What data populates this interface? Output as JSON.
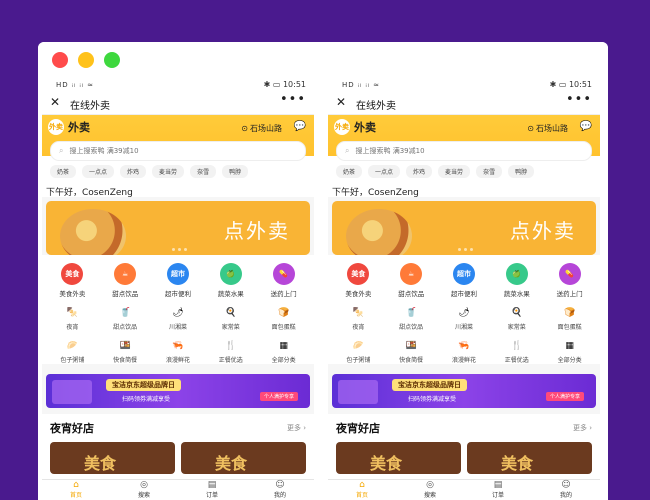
{
  "status": {
    "signal": "HD ᵢₗ ᵢₗ ≈",
    "time": "10:51",
    "battery": "✱ ▭"
  },
  "nav": {
    "title": "在线外卖"
  },
  "brand": {
    "logo_text": "外卖",
    "name": "外卖",
    "location": "石场山路"
  },
  "search": {
    "placeholder": "搜上搜索鸭 满39减10"
  },
  "tags": [
    "奶茶",
    "一点点",
    "炸鸡",
    "麦当劳",
    "奈雪",
    "鸭脖"
  ],
  "greeting": "下午好，CosenZeng",
  "banner": {
    "title": "点外卖"
  },
  "categories": [
    {
      "icon_text": "美食",
      "label": "美食外卖"
    },
    {
      "icon_text": "☕",
      "label": "甜点饮品"
    },
    {
      "icon_text": "超市",
      "label": "超市便利"
    },
    {
      "icon_text": "🍏",
      "label": "蔬菜水果"
    },
    {
      "icon_text": "💊",
      "label": "送药上门"
    }
  ],
  "sub_row1": [
    {
      "icon": "🍢",
      "label": "夜宵"
    },
    {
      "icon": "🥤",
      "label": "甜点饮品"
    },
    {
      "icon": "🌶",
      "label": "川湘菜"
    },
    {
      "icon": "🍳",
      "label": "家常菜"
    },
    {
      "icon": "🍞",
      "label": "面包蛋糕"
    }
  ],
  "sub_row2": [
    {
      "icon": "🥟",
      "label": "包子粥铺"
    },
    {
      "icon": "🍱",
      "label": "快食简餐"
    },
    {
      "icon": "🦐",
      "label": "浪漫鲜花"
    },
    {
      "icon": "🍴",
      "label": "正餐优选"
    },
    {
      "icon": "▦",
      "label": "全部分类"
    }
  ],
  "promo": {
    "line1": "宝洁京东超级品牌日",
    "line2": "扫码领券满减享受",
    "tag": "个人满护专享"
  },
  "stores": {
    "title": "夜宵好店",
    "more": "更多 ›",
    "card_label": "美食"
  },
  "tabs": [
    {
      "icon": "⌂",
      "label": "首页"
    },
    {
      "icon": "◎",
      "label": "搜索"
    },
    {
      "icon": "▤",
      "label": "订单"
    },
    {
      "icon": "☺",
      "label": "我的"
    }
  ],
  "colors": {
    "accent": "#ffc22e",
    "background": "#4a1a8e"
  }
}
